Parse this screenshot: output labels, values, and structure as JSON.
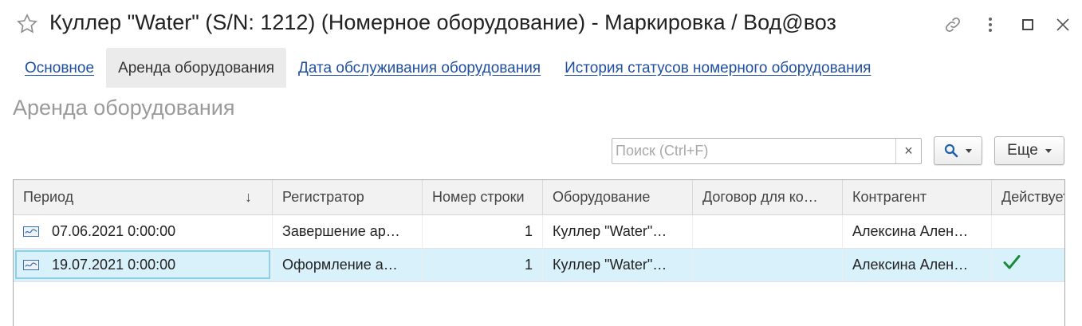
{
  "window": {
    "title": "Куллер \"Water\" (S/N: 1212) (Номерное оборудование) - Маркировка / Вод@воз",
    "icons": [
      "star-icon",
      "link-icon",
      "more-vertical-icon",
      "maximize-icon",
      "close-icon"
    ]
  },
  "tabs": [
    {
      "label": "Основное",
      "active": false
    },
    {
      "label": "Аренда оборудования",
      "active": true
    },
    {
      "label": "Дата обслуживания оборудования",
      "active": false
    },
    {
      "label": "История статусов номерного оборудования",
      "active": false
    }
  ],
  "section": {
    "title": "Аренда оборудования"
  },
  "toolbar": {
    "search_placeholder": "Поиск (Ctrl+F)",
    "search_value": "",
    "clear_label": "×",
    "more_label": "Еще"
  },
  "table": {
    "sort_indicator": "↓",
    "columns": [
      "Период",
      "Регистратор",
      "Номер строки",
      "Оборудование",
      "Договор для ко…",
      "Контрагент",
      "Действует"
    ],
    "rows": [
      {
        "period": "07.06.2021 0:00:00",
        "registrar": "Завершение ар…",
        "line_no": "1",
        "equipment": "Куллер \"Water\"…",
        "contract": "",
        "counterparty": "Алексина Ален…",
        "active": false,
        "selected": false
      },
      {
        "period": "19.07.2021 0:00:00",
        "registrar": "Оформление а…",
        "line_no": "1",
        "equipment": "Куллер \"Water\"…",
        "contract": "",
        "counterparty": "Алексина Ален…",
        "active": true,
        "selected": true
      }
    ]
  },
  "colors": {
    "link": "#1f4fa3",
    "selected_row": "#d9f1fb",
    "check": "#1a8a3a",
    "section_title": "#9a9a9a"
  }
}
